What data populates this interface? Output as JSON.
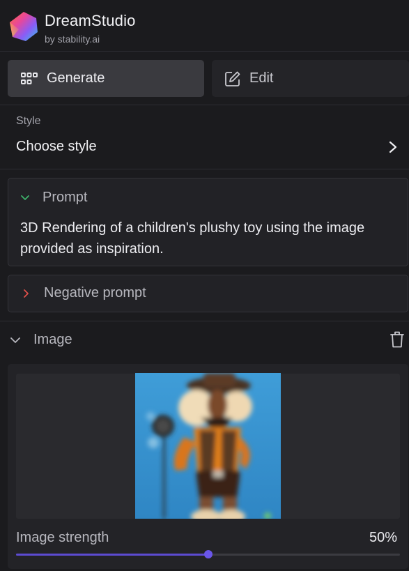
{
  "header": {
    "title": "DreamStudio",
    "subtitle": "by stability.ai",
    "logo_icon": "dreamstudio-logo"
  },
  "tabs": [
    {
      "label": "Generate",
      "icon": "grid-icon",
      "active": true
    },
    {
      "label": "Edit",
      "icon": "edit-icon",
      "active": false
    }
  ],
  "style": {
    "caption": "Style",
    "value": "Choose style",
    "icon": "chevron-right-icon"
  },
  "prompt": {
    "label": "Prompt",
    "expanded": true,
    "text": "3D Rendering of a children's plushy toy using the image provided as inspiration.",
    "chevron_color": "#3fb36b"
  },
  "negative_prompt": {
    "label": "Negative prompt",
    "expanded": false,
    "chevron_color": "#e0504a"
  },
  "image": {
    "label": "Image",
    "expanded": true,
    "delete_icon": "trash-icon",
    "strength_label": "Image strength",
    "strength_value": "50%",
    "strength_fraction": 0.5
  },
  "colors": {
    "background": "#1b1b1e",
    "accent": "#6a56ea",
    "active_tab": "#3a3a3f"
  }
}
